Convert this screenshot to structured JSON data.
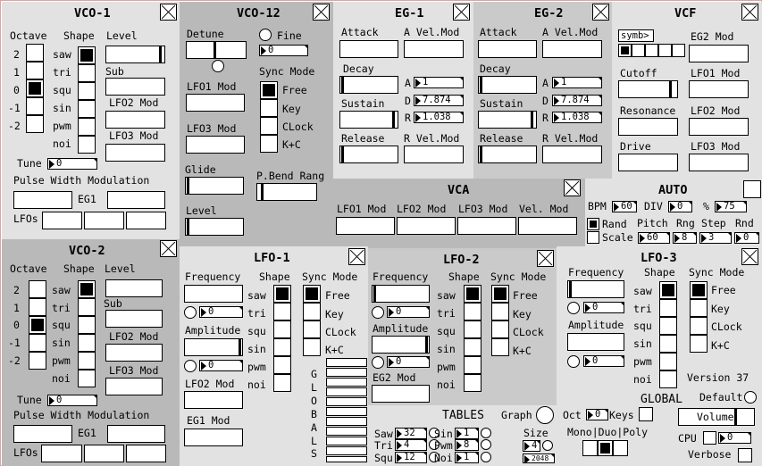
{
  "vco1": {
    "title": "VCO-1",
    "octave": "Octave",
    "shape": "Shape",
    "level": "Level",
    "sub": "Sub",
    "lfo2mod": "LFO2 Mod",
    "lfo3mod": "LFO3 Mod",
    "tune": "Tune",
    "tune_value": "0",
    "pwm_title": "Pulse Width Modulation",
    "eg1": "EG1",
    "lfos": "LFOs",
    "octaves": [
      "2",
      "1",
      "0",
      "-1",
      "-2"
    ],
    "shapes": [
      "saw",
      "tri",
      "squ",
      "sin",
      "pwm",
      "noi"
    ]
  },
  "vco2": {
    "title": "VCO-2",
    "octave": "Octave",
    "shape": "Shape",
    "level": "Level",
    "sub": "Sub",
    "lfo2mod": "LFO2 Mod",
    "lfo3mod": "LFO3 Mod",
    "tune": "Tune",
    "tune_value": "0",
    "pwm_title": "Pulse Width Modulation",
    "eg1": "EG1",
    "lfos": "LFOs",
    "octaves": [
      "2",
      "1",
      "0",
      "-1",
      "-2"
    ],
    "shapes": [
      "saw",
      "tri",
      "squ",
      "sin",
      "pwm",
      "noi"
    ]
  },
  "vco12": {
    "title": "VCO-12",
    "detune": "Detune",
    "fine": "Fine",
    "fine_value": "0",
    "lfo1mod": "LFO1 Mod",
    "lfo3mod": "LFO3 Mod",
    "glide": "Glide",
    "level": "Level",
    "sync_mode": "Sync Mode",
    "sync_opts": [
      "Free",
      "Key",
      "CLock",
      "K+C"
    ],
    "pbend": "P.Bend Rang"
  },
  "eg1": {
    "title": "EG-1",
    "attack": "Attack",
    "avel": "A Vel.Mod",
    "decay": "Decay",
    "sustain": "Sustain",
    "release": "Release",
    "rvel": "R Vel.Mod",
    "a": "A",
    "d": "D",
    "r": "R",
    "a_val": "1",
    "d_val": "7.874",
    "r_val": "1.038"
  },
  "eg2": {
    "title": "EG-2",
    "attack": "Attack",
    "avel": "A Vel.Mod",
    "decay": "Decay",
    "sustain": "Sustain",
    "release": "Release",
    "rvel": "R Vel.Mod",
    "a": "A",
    "d": "D",
    "r": "R",
    "a_val": "1",
    "d_val": "7.874",
    "r_val": "1.038"
  },
  "vcf": {
    "title": "VCF",
    "symb": "symb>",
    "eg2mod": "EG2 Mod",
    "cutoff": "Cutoff",
    "lfo1mod": "LFO1 Mod",
    "resonance": "Resonance",
    "lfo2mod": "LFO2 Mod",
    "drive": "Drive",
    "lfo3mod": "LFO3 Mod"
  },
  "vca": {
    "title": "VCA",
    "lfo1": "LFO1 Mod",
    "lfo2": "LFO2 Mod",
    "lfo3": "LFO3 Mod",
    "vel": "Vel. Mod"
  },
  "auto": {
    "title": "AUTO",
    "bpm": "BPM",
    "bpm_val": "60",
    "div": "DIV",
    "div_val": "0",
    "pct": "%",
    "pct_val": "75",
    "rand": "Rand",
    "scale": "Scale",
    "pitch": "Pitch",
    "rng": "Rng",
    "step": "Step",
    "rnd": "Rnd",
    "pitch_val": "60",
    "rng_val": "8",
    "step_val": "3",
    "rnd_val": "0"
  },
  "lfo1": {
    "title": "LFO-1",
    "frequency": "Frequency",
    "shape": "Shape",
    "sync_mode": "Sync Mode",
    "amplitude": "Amplitude",
    "lfo2mod": "LFO2 Mod",
    "eg1mod": "EG1 Mod",
    "freq_val": "0",
    "amp_val": "0",
    "shapes": [
      "saw",
      "tri",
      "squ",
      "sin",
      "pwm",
      "noi"
    ],
    "syncs": [
      "Free",
      "Key",
      "CLock",
      "K+C"
    ]
  },
  "lfo2": {
    "title": "LFO-2",
    "frequency": "Frequency",
    "shape": "Shape",
    "sync_mode": "Sync Mode",
    "amplitude": "Amplitude",
    "eg2mod": "EG2 Mod",
    "freq_val": "0",
    "amp_val": "0",
    "shapes": [
      "saw",
      "tri",
      "squ",
      "sin",
      "pwm",
      "noi"
    ],
    "syncs": [
      "Free",
      "Key",
      "CLock",
      "K+C"
    ]
  },
  "lfo3": {
    "title": "LFO-3",
    "frequency": "Frequency",
    "shape": "Shape",
    "sync_mode": "Sync Mode",
    "amplitude": "Amplitude",
    "freq_val": "0",
    "amp_val": "0",
    "shapes": [
      "saw",
      "tri",
      "squ",
      "sin",
      "pwm",
      "noi"
    ],
    "syncs": [
      "Free",
      "Key",
      "CLock",
      "K+C"
    ],
    "version": "Version 37"
  },
  "globals": {
    "letters": [
      "G",
      "L",
      "O",
      "B",
      "A",
      "L",
      "S"
    ]
  },
  "tables": {
    "title": "TABLES",
    "graph": "Graph",
    "saw": "Saw",
    "tri": "Tri",
    "squ": "Squ",
    "sin": "Sin",
    "pwm": "Pwm",
    "noi": "Noi",
    "size": "Size",
    "saw_val": "32",
    "tri_val": "4",
    "squ_val": "12",
    "sin_val": "1",
    "pwm_val": "8",
    "noi_val": "1",
    "size_val": "4",
    "size_total": "2048"
  },
  "global": {
    "title": "GLOBAL",
    "default": "Default",
    "oct": "Oct",
    "oct_val": "0",
    "keys": "Keys",
    "volume": "Volume",
    "mono": "Mono|Duo|Poly",
    "cpu": "CPU",
    "cpu_val": "0",
    "verbose": "Verbose"
  },
  "colors": {
    "dark": "#b9b9b9",
    "mid": "#cacaca",
    "light": "#e2e2e2",
    "border": "#e0a0a0"
  }
}
